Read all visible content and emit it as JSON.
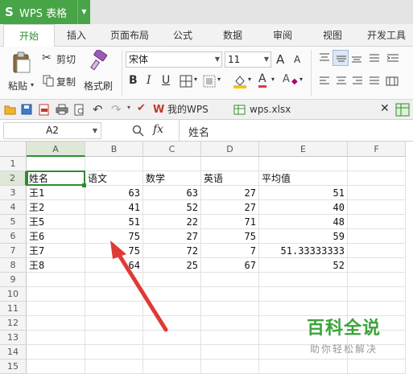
{
  "app": {
    "logo": "S",
    "name": "WPS 表格"
  },
  "tabs": [
    "开始",
    "插入",
    "页面布局",
    "公式",
    "数据",
    "审阅",
    "视图",
    "开发工具"
  ],
  "ribbon": {
    "paste": "粘贴",
    "cut": "剪切",
    "copy": "复制",
    "format_painter": "格式刷",
    "font_name": "宋体",
    "font_size": "11",
    "bold": "B",
    "italic": "I",
    "underline": "U",
    "grow_font": "A",
    "shrink_font": "A",
    "font_color_letter": "A",
    "clear_letter": "A"
  },
  "doc_tabs": [
    {
      "label": "我的WPS",
      "icon": "wps-icon"
    },
    {
      "label": "wps.xlsx *",
      "icon": "spreadsheet-icon"
    }
  ],
  "formula_bar": {
    "cell_ref": "A2",
    "fx": "fx",
    "content": "姓名"
  },
  "columns": [
    "A",
    "B",
    "C",
    "D",
    "E",
    "F"
  ],
  "rows": [
    "1",
    "2",
    "3",
    "4",
    "5",
    "6",
    "7",
    "8",
    "9",
    "10",
    "11",
    "12",
    "13",
    "14",
    "15"
  ],
  "sheet": {
    "header": [
      "姓名",
      "语文",
      "数学",
      "英语",
      "平均值"
    ],
    "data": [
      [
        "王1",
        "63",
        "63",
        "27",
        "51"
      ],
      [
        "王2",
        "41",
        "52",
        "27",
        "40"
      ],
      [
        "王5",
        "51",
        "22",
        "71",
        "48"
      ],
      [
        "王6",
        "75",
        "27",
        "75",
        "59"
      ],
      [
        "王7",
        "75",
        "72",
        "7",
        "51.33333333"
      ],
      [
        "王8",
        "64",
        "25",
        "67",
        "52"
      ]
    ]
  },
  "watermark": {
    "title": "百科全说",
    "subtitle": "助你轻松解决"
  },
  "colors": {
    "accent": "#47a447",
    "arrow": "#e03a36",
    "selection": "#2e8b2e",
    "watermark": "#3aa33a"
  }
}
